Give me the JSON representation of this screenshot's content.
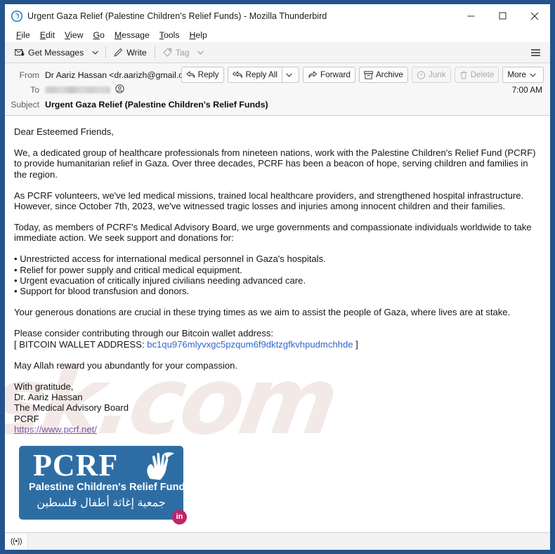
{
  "window": {
    "title": "Urgent Gaza Relief (Palestine Children's Relief Funds) - Mozilla Thunderbird",
    "app_icon": "thunderbird-icon",
    "controls": {
      "minimize": "minimize-icon",
      "maximize": "maximize-icon",
      "close": "close-icon"
    },
    "border_color": "#23548c"
  },
  "menubar": {
    "items": [
      {
        "label": "File",
        "accesskey": "F"
      },
      {
        "label": "Edit",
        "accesskey": "E"
      },
      {
        "label": "View",
        "accesskey": "V"
      },
      {
        "label": "Go",
        "accesskey": "G"
      },
      {
        "label": "Message",
        "accesskey": "M"
      },
      {
        "label": "Tools",
        "accesskey": "T"
      },
      {
        "label": "Help",
        "accesskey": "H"
      }
    ]
  },
  "toolbar": {
    "get_messages": "Get Messages",
    "write": "Write",
    "tag": "Tag",
    "app_menu": "hamburger-menu-icon"
  },
  "message_header": {
    "from_label": "From",
    "from_value": "Dr Aariz Hassan <dr.aarizh@gmail.com>",
    "to_label": "To",
    "to_value": "",
    "subject_label": "Subject",
    "subject_value": "Urgent Gaza Relief (Palestine Children's Relief Funds)",
    "time": "7:00 AM",
    "actions": {
      "reply": "Reply",
      "reply_all": "Reply All",
      "forward": "Forward",
      "archive": "Archive",
      "junk": "Junk",
      "delete": "Delete",
      "more": "More"
    }
  },
  "body": {
    "watermark": "sk.com",
    "greeting": "Dear Esteemed Friends,",
    "paragraph_1": "We, a dedicated group of healthcare professionals from nineteen nations, work with the Palestine Children's Relief Fund (PCRF) to provide humanitarian relief in Gaza. Over three decades, PCRF has been a beacon of hope, serving children and families in the region.",
    "paragraph_2": "As PCRF volunteers, we've led medical missions, trained local healthcare providers, and strengthened hospital infrastructure. However, since October 7th, 2023, we've witnessed tragic losses and injuries among innocent children and their families.",
    "paragraph_3": "Today, as members of PCRF's Medical Advisory Board, we urge governments and compassionate individuals worldwide to take immediate action. We seek support and donations for:",
    "bullets": [
      "• Unrestricted access for international medical personnel in Gaza's hospitals.",
      "• Relief for power supply and critical medical equipment.",
      "• Urgent evacuation of critically injured civilians needing advanced care.",
      "• Support for blood transfusion and donors."
    ],
    "paragraph_4": "Your generous donations are crucial in these trying times as we aim to assist the people of Gaza, where lives are at stake.",
    "paragraph_5": "Please consider contributing through our Bitcoin wallet address:",
    "wallet_prefix": "[ BITCOIN WALLET ADDRESS: ",
    "wallet_address": "bc1qu976mlyvxgc5pzqum6f9dktzgfkvhpudmchhde",
    "wallet_suffix": " ]",
    "paragraph_6": "May Allah reward you abundantly for your compassion.",
    "signature": {
      "line_1": "With gratitude,",
      "line_2": "Dr. Aariz Hassan",
      "line_3": "The Medical Advisory Board",
      "line_4": "PCRF",
      "link": "https://www.pcrf.net/"
    },
    "link_color": "#3366cc",
    "visited_link_color": "#7d53a8"
  },
  "logo": {
    "acronym": "PCRF",
    "name": "Palestine Children's Relief Fund",
    "arabic": "جمعية إغاثة أطفال فلسطين",
    "badge": "in",
    "background_color": "#2e6da4",
    "badge_color": "#c0246b"
  },
  "statusbar": {
    "icon": "broadcast-icon",
    "icon_glyph": "((•))",
    "text": ""
  }
}
